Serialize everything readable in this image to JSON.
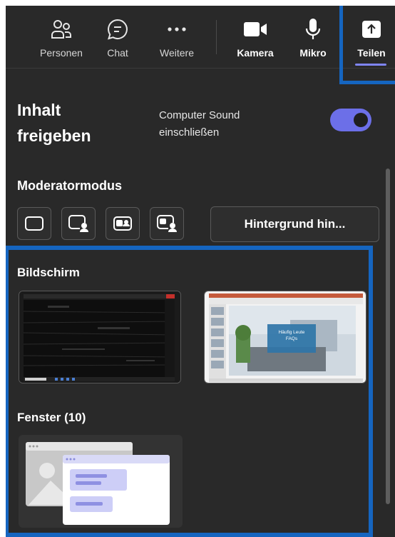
{
  "toolbar": {
    "people": {
      "label": "Personen",
      "icon": "people-icon"
    },
    "chat": {
      "label": "Chat",
      "icon": "chat-icon"
    },
    "more": {
      "label": "Weitere",
      "icon": "more-dots-icon"
    },
    "camera": {
      "label": "Kamera",
      "icon": "camera-icon"
    },
    "mic": {
      "label": "Mikro",
      "icon": "microphone-icon"
    },
    "share": {
      "label": "Teilen",
      "icon": "share-upload-icon"
    }
  },
  "share_panel": {
    "title": "Inhalt freigeben",
    "computer_sound_label": "Computer Sound einschließen",
    "computer_sound_on": true,
    "presenter_mode_title": "Moderatormodus",
    "presenter_modes": [
      {
        "icon": "content-only-icon"
      },
      {
        "icon": "standout-icon"
      },
      {
        "icon": "side-by-side-icon"
      },
      {
        "icon": "reporter-icon"
      }
    ],
    "background_button": "Hintergrund hin...",
    "screen_section_title": "Bildschirm",
    "windows_section_title": "Fenster (10)",
    "slide_caption_line1": "Häufig Leute",
    "slide_caption_line2": "FAQs"
  },
  "colors": {
    "panel_bg": "#292929",
    "accent": "#6c6fe8",
    "highlight_box": "#1565c0"
  }
}
